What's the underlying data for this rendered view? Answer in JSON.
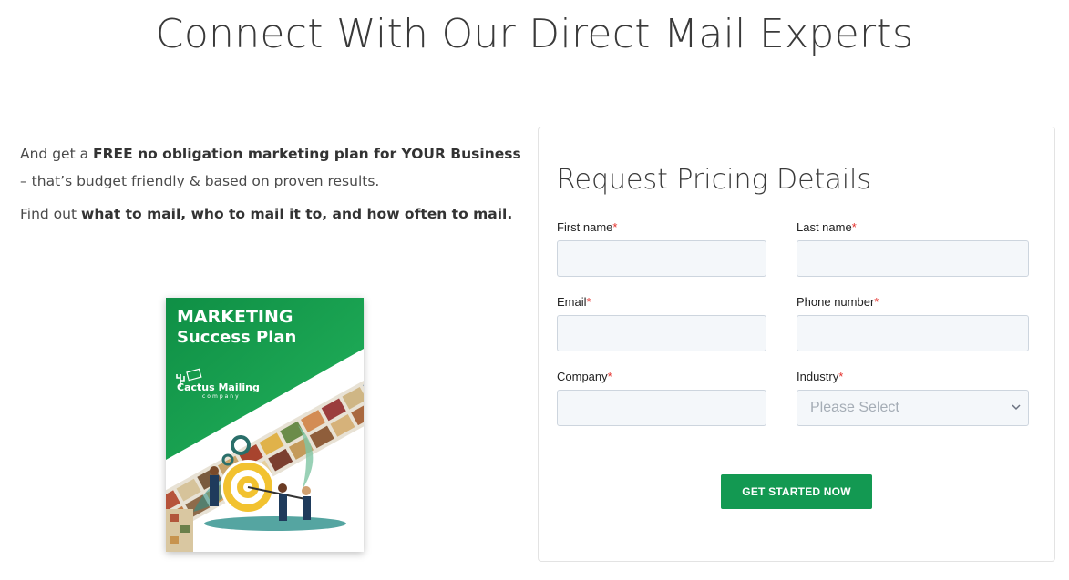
{
  "headline": "Connect With Our Direct Mail Experts",
  "intro": {
    "p1_prefix": "And get a ",
    "p1_bold": "FREE no obligation marketing plan for YOUR Business",
    "p1_suffix": " – that’s budget friendly & based on proven results.",
    "p2_prefix": "Find out ",
    "p2_bold": "what to mail, who to mail it to, and how often to mail."
  },
  "book": {
    "title_line1": "MARKETING",
    "title_line2": "Success Plan",
    "brand": "Cactus Mailing",
    "brand_sub": "company",
    "colors": {
      "green_dark": "#0f8f45",
      "green_light": "#1fb25a",
      "gold": "#f2c230",
      "teal": "#2a8f8a"
    }
  },
  "form": {
    "title": "Request Pricing Details",
    "fields": {
      "first_name": {
        "label": "First name",
        "required": "*",
        "value": ""
      },
      "last_name": {
        "label": "Last name",
        "required": "*",
        "value": ""
      },
      "email": {
        "label": "Email",
        "required": "*",
        "value": ""
      },
      "phone": {
        "label": "Phone number",
        "required": "*",
        "value": ""
      },
      "company": {
        "label": "Company",
        "required": "*",
        "value": ""
      },
      "industry": {
        "label": "Industry",
        "required": "*",
        "selected": "Please Select"
      }
    },
    "submit_label": "GET STARTED NOW",
    "colors": {
      "button": "#139952",
      "required": "#e4302b",
      "input_bg": "#f4f7fa"
    }
  }
}
